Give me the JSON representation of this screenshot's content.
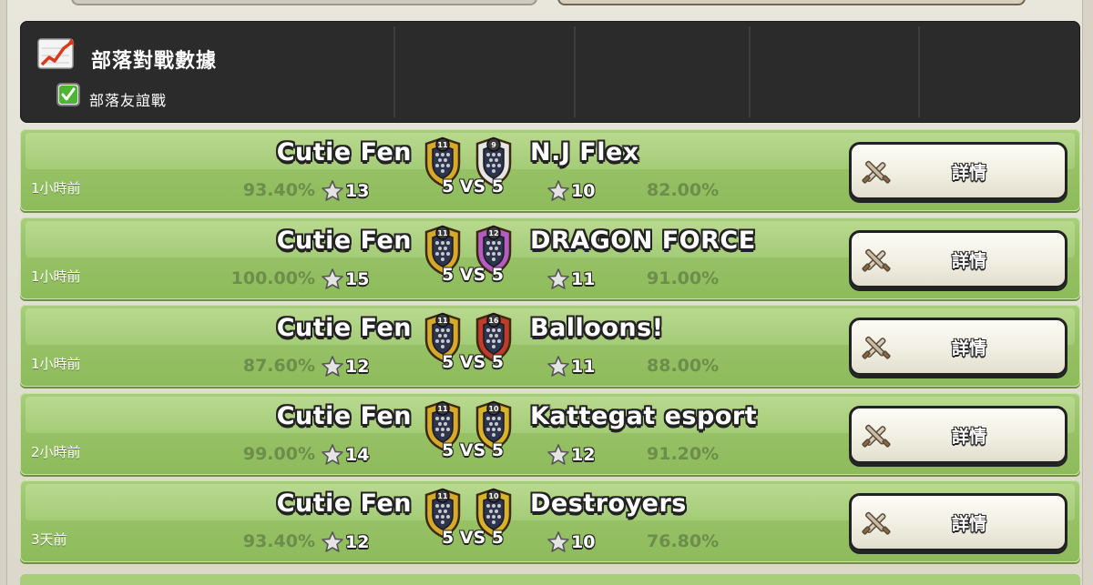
{
  "header": {
    "title": "部落對戰數據",
    "checkbox_label": "部落友誼戰",
    "checkbox_checked": true
  },
  "rows": [
    {
      "time": "1小時前",
      "left_name": "Cutie Fen",
      "left_level": "11",
      "left_pct": "93.40%",
      "left_stars": "13",
      "vs": "5 VS 5",
      "right_name": "N.J Flex",
      "right_level": "9",
      "right_pct": "82.00%",
      "right_stars": "10",
      "right_badge_color": "#e5e5e5",
      "button_label": "詳情"
    },
    {
      "time": "1小時前",
      "left_name": "Cutie Fen",
      "left_level": "11",
      "left_pct": "100.00%",
      "left_stars": "15",
      "vs": "5 VS 5",
      "right_name": "DRAGON FORCE",
      "right_level": "12",
      "right_pct": "91.00%",
      "right_stars": "11",
      "right_badge_color": "#b55bc4",
      "button_label": "詳情"
    },
    {
      "time": "1小時前",
      "left_name": "Cutie Fen",
      "left_level": "11",
      "left_pct": "87.60%",
      "left_stars": "12",
      "vs": "5 VS 5",
      "right_name": "Balloons!",
      "right_level": "16",
      "right_pct": "88.00%",
      "right_stars": "11",
      "right_badge_color": "#c23a2a",
      "button_label": "詳情"
    },
    {
      "time": "2小時前",
      "left_name": "Cutie Fen",
      "left_level": "11",
      "left_pct": "99.00%",
      "left_stars": "14",
      "vs": "5 VS 5",
      "right_name": "Kattegat esport",
      "right_level": "10",
      "right_pct": "91.20%",
      "right_stars": "12",
      "right_badge_color": "#d8b22c",
      "button_label": "詳情"
    },
    {
      "time": "3天前",
      "left_name": "Cutie Fen",
      "left_level": "11",
      "left_pct": "93.40%",
      "left_stars": "12",
      "vs": "5 VS 5",
      "right_name": "Destroyers",
      "right_level": "10",
      "right_pct": "76.80%",
      "right_stars": "10",
      "right_badge_color": "#d8b22c",
      "button_label": "詳情"
    }
  ],
  "colors": {
    "row_green": "#98c268",
    "header_dark": "#2b2b2c",
    "pct_text": "#6c8d4b",
    "gold_badge": "#d6a92b"
  },
  "icons": {
    "header": "chart-trend-icon",
    "checkbox": "checkmark-icon",
    "star": "star-icon",
    "button": "crossed-swords-icon",
    "clan_badge": "clan-badge-icon"
  }
}
